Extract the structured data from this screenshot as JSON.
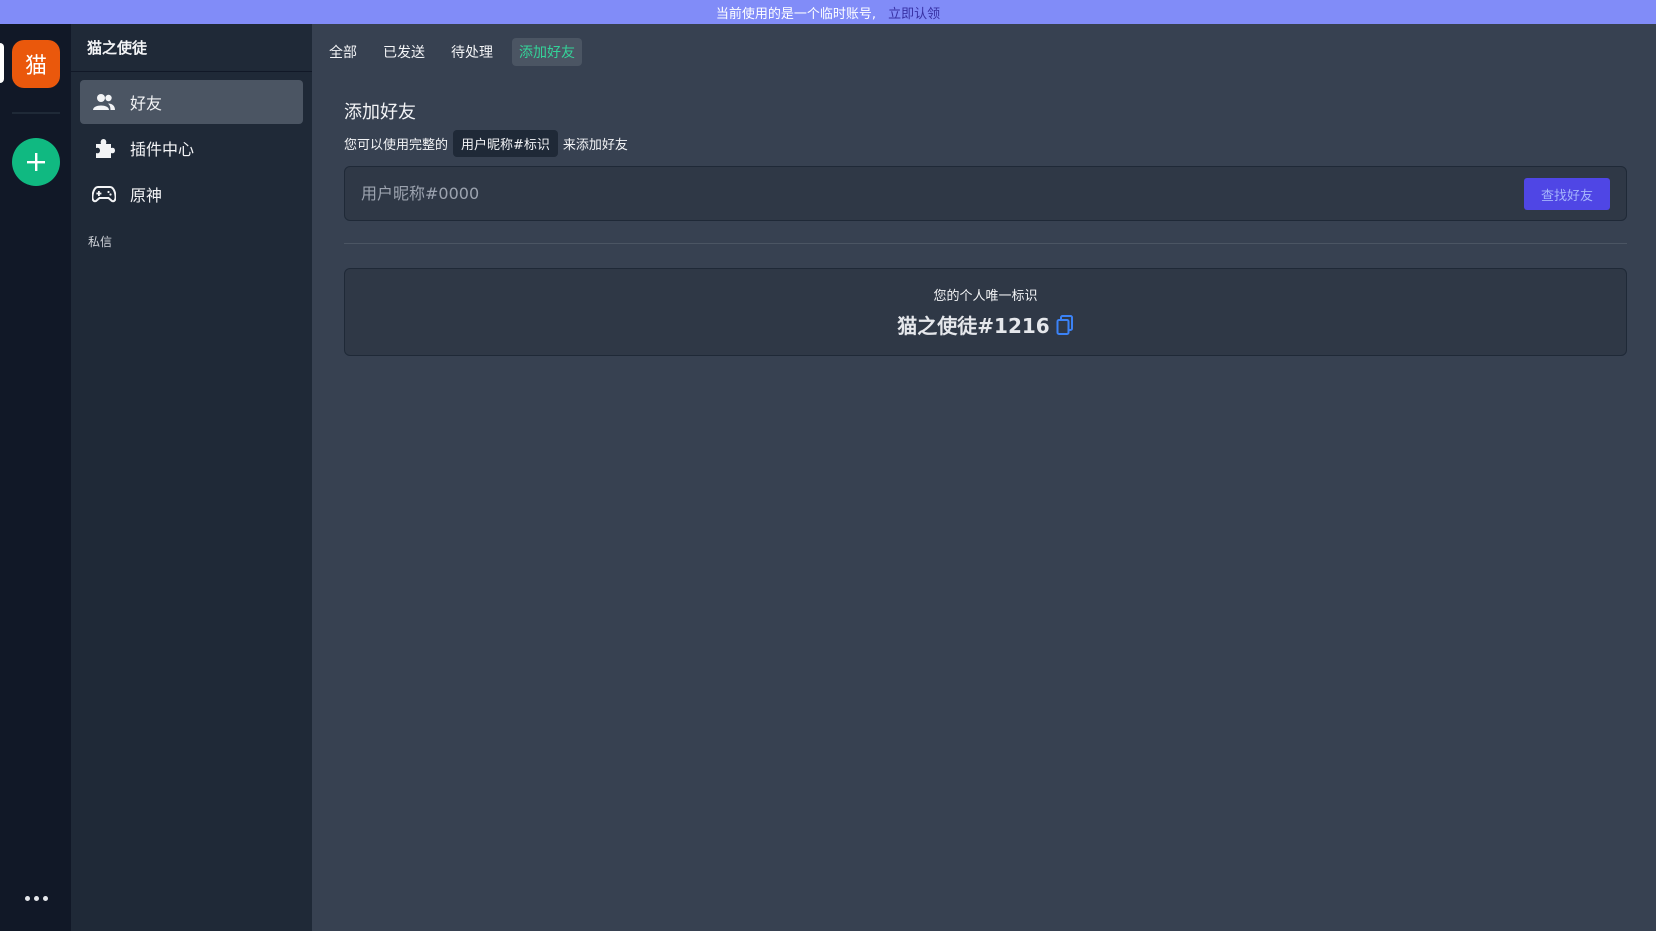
{
  "banner": {
    "message": "当前使用的是一个临时账号,",
    "claim_label": "立即认领"
  },
  "server_rail": {
    "server_initial": "猫",
    "colors": {
      "server_avatar": "#ea580c",
      "add_button": "#10b981"
    }
  },
  "channel_panel": {
    "title": "猫之使徒",
    "items": [
      {
        "label": "好友",
        "icon": "users-icon"
      },
      {
        "label": "插件中心",
        "icon": "puzzle-icon"
      },
      {
        "label": "原神",
        "icon": "gamepad-icon"
      }
    ],
    "section_label": "私信"
  },
  "main": {
    "tabs": [
      {
        "label": "全部"
      },
      {
        "label": "已发送"
      },
      {
        "label": "待处理"
      },
      {
        "label": "添加好友"
      }
    ],
    "add_friend": {
      "title": "添加好友",
      "desc_prefix": "您可以使用完整的",
      "desc_code": "用户昵称#标识",
      "desc_suffix": "来添加好友",
      "input_placeholder": "用户昵称#0000",
      "find_button": "查找好友"
    },
    "identity": {
      "label": "您的个人唯一标识",
      "value": "猫之使徒#1216"
    }
  },
  "colors": {
    "banner": "#818cf8",
    "accent": "#4f46e5",
    "active_tab_text": "#34d399",
    "copy_icon": "#3b82f6"
  }
}
